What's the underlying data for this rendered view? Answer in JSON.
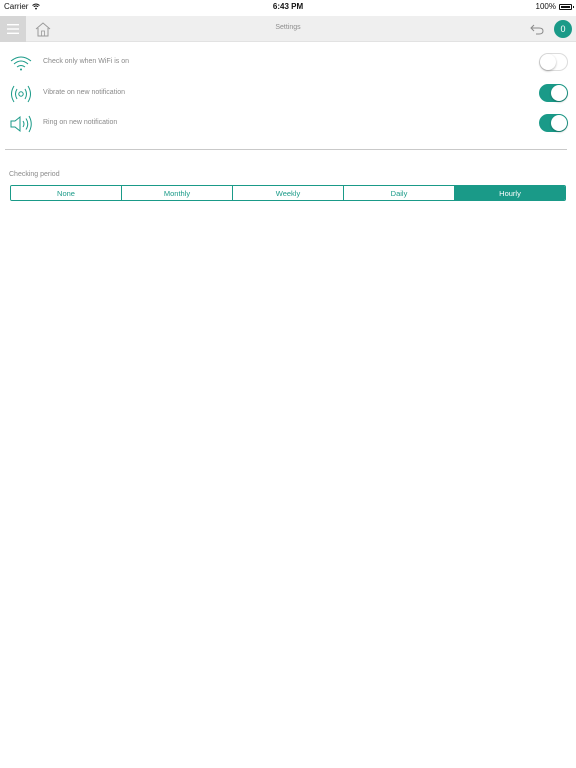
{
  "status_bar": {
    "carrier": "Carrier",
    "time": "6:43 PM",
    "battery": "100%"
  },
  "nav": {
    "title": "Settings",
    "badge_count": "0",
    "accent_color": "#1a9a88"
  },
  "settings": [
    {
      "icon": "wifi-icon",
      "label": "Check only when WiFi is on",
      "enabled": false
    },
    {
      "icon": "vibrate-icon",
      "label": "Vibrate on new notification",
      "enabled": true
    },
    {
      "icon": "speaker-icon",
      "label": "Ring on new notification",
      "enabled": true
    }
  ],
  "checking_period": {
    "label": "Checking period",
    "options": [
      "None",
      "Monthly",
      "Weekly",
      "Daily",
      "Hourly"
    ],
    "selected": "Hourly"
  }
}
